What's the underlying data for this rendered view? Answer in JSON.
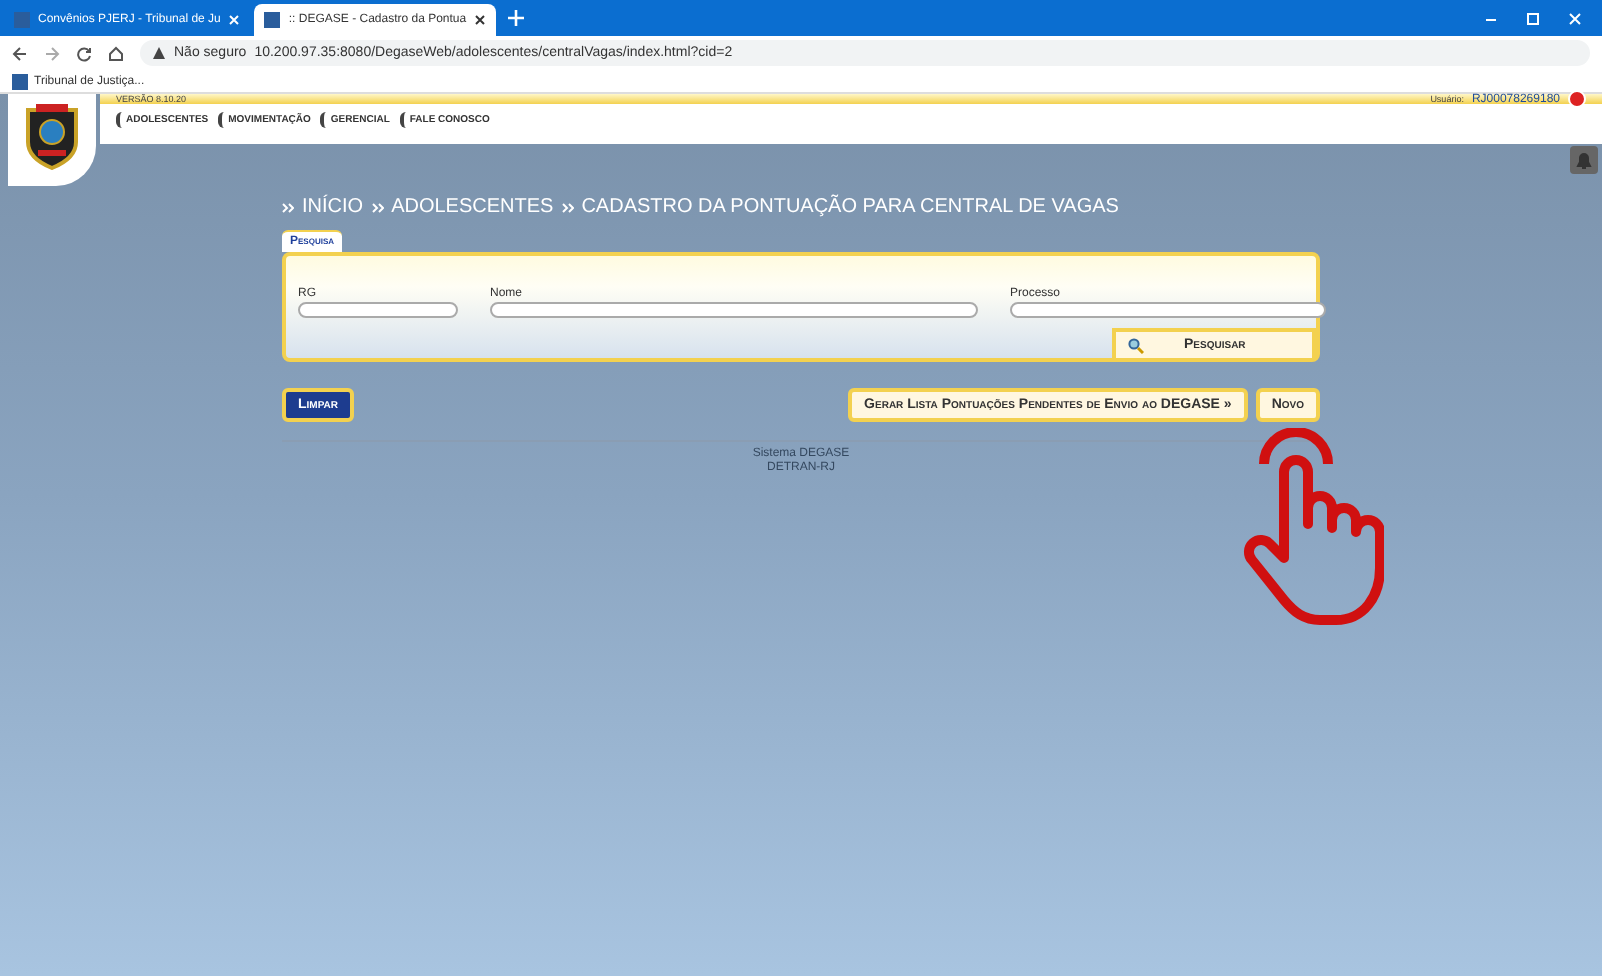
{
  "browser": {
    "tabs": [
      {
        "label": "Convênios PJERJ - Tribunal de Ju",
        "selected": false
      },
      {
        "label": ":: DEGASE - Cadastro da Pontua",
        "selected": true
      }
    ],
    "security": "Não seguro",
    "url": "10.200.97.35:8080/DegaseWeb/adolescentes/centralVagas/index.html?cid=2",
    "bookmarks": [
      "Tribunal de Justiça..."
    ]
  },
  "header": {
    "version": "VERSÃO 8.10.20",
    "user_label": "Usuário:",
    "user": "RJ00078269180"
  },
  "menu": [
    "ADOLESCENTES",
    "MOVIMENTAÇÃO",
    "GERENCIAL",
    "FALE CONOSCO"
  ],
  "breadcrumb": [
    "INÍCIO",
    "ADOLESCENTES",
    "CADASTRO DA PONTUAÇÃO PARA CENTRAL DE VAGAS"
  ],
  "search_panel": {
    "title": "Pesquisa",
    "fields": [
      {
        "label": "RG"
      },
      {
        "label": "Nome"
      },
      {
        "label": "Processo"
      }
    ],
    "button": "Pesquisar"
  },
  "actions": {
    "clear": "Limpar",
    "generate": "Gerar Lista Pontuações Pendentes de Envio ao DEGASE »",
    "new": "Novo"
  },
  "footer": [
    "Sistema DEGASE",
    "DETRAN-RJ"
  ]
}
